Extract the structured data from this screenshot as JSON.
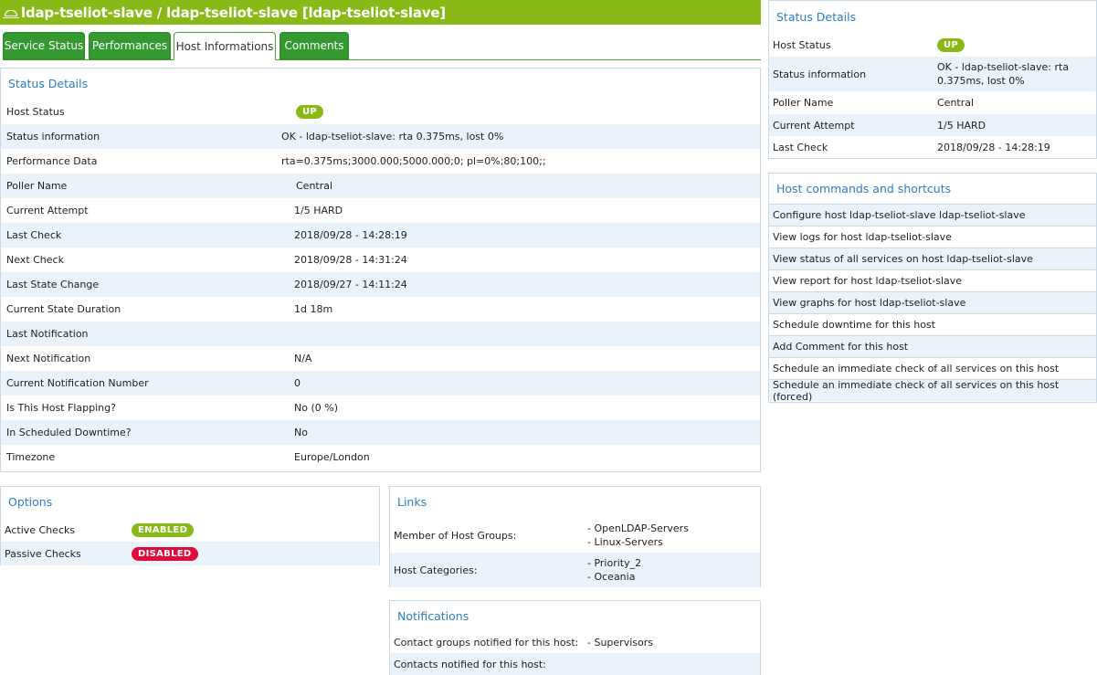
{
  "page_title": "ldap-tseliot-slave / ldap-tseliot-slave [ldap-tseliot-slave]",
  "tabs": [
    {
      "label": "Service Status"
    },
    {
      "label": "Performances"
    },
    {
      "label": "Host Informations"
    },
    {
      "label": "Comments"
    }
  ],
  "status_details": {
    "title": "Status Details",
    "rows": [
      {
        "label": "Host Status",
        "value": "UP"
      },
      {
        "label": "Status information",
        "value": "OK - ldap-tseliot-slave: rta 0.375ms, lost 0%"
      },
      {
        "label": "Performance Data",
        "value": "rta=0.375ms;3000.000;5000.000;0; pl=0%;80;100;;"
      },
      {
        "label": "Poller Name",
        "value": "Central"
      },
      {
        "label": "Current Attempt",
        "value": "1/5 HARD"
      },
      {
        "label": "Last Check",
        "value": "2018/09/28 - 14:28:19"
      },
      {
        "label": "Next Check",
        "value": "2018/09/28 - 14:31:24"
      },
      {
        "label": "Last State Change",
        "value": "2018/09/27 - 14:11:24"
      },
      {
        "label": "Current State Duration",
        "value": "1d 18m"
      },
      {
        "label": "Last Notification",
        "value": ""
      },
      {
        "label": "Next Notification",
        "value": "N/A"
      },
      {
        "label": "Current Notification Number",
        "value": "0"
      },
      {
        "label": "Is This Host Flapping?",
        "value": "No (0 %)"
      },
      {
        "label": "In Scheduled Downtime?",
        "value": "No"
      },
      {
        "label": "Timezone",
        "value": "Europe/London"
      }
    ]
  },
  "options": {
    "title": "Options",
    "rows": [
      {
        "label": "Active Checks",
        "value": "ENABLED"
      },
      {
        "label": "Passive Checks",
        "value": "DISABLED"
      }
    ]
  },
  "links": {
    "title": "Links",
    "rows": [
      {
        "label": "Member of Host Groups:",
        "values": [
          "- OpenLDAP-Servers",
          "- Linux-Servers"
        ]
      },
      {
        "label": "Host Categories:",
        "values": [
          "- Priority_2",
          "- Oceania"
        ]
      }
    ]
  },
  "notifications": {
    "title": "Notifications",
    "rows": [
      {
        "label": "Contact groups notified for this host:",
        "value": "- Supervisors"
      },
      {
        "label": "Contacts notified for this host:",
        "value": ""
      }
    ]
  },
  "side_status": {
    "title": "Status Details",
    "rows": [
      {
        "label": "Host Status",
        "value": "UP"
      },
      {
        "label": "Status information",
        "values": [
          "OK - ldap-tseliot-slave: rta",
          "0.375ms, lost 0%"
        ]
      },
      {
        "label": "Poller Name",
        "value": "Central"
      },
      {
        "label": "Current Attempt",
        "value": "1/5 HARD"
      },
      {
        "label": "Last Check",
        "value": "2018/09/28 - 14:28:19"
      }
    ]
  },
  "commands": {
    "title": "Host commands and shortcuts",
    "items": [
      "Configure host ldap-tseliot-slave ldap-tseliot-slave",
      "View logs for host ldap-tseliot-slave",
      "View status of all services on host ldap-tseliot-slave",
      "View report for host ldap-tseliot-slave",
      "View graphs for host ldap-tseliot-slave",
      "Schedule downtime for this host",
      "Add Comment for this host",
      "Schedule an immediate check of all services on this host",
      "Schedule an immediate check of all services on this host (forced)"
    ]
  },
  "colors": {
    "brand_green": "#88b917",
    "tab_green": "#339930",
    "link_blue": "#2d7cc1",
    "row_alt": "#eaf2fa",
    "disabled_red": "#e00b3d"
  }
}
